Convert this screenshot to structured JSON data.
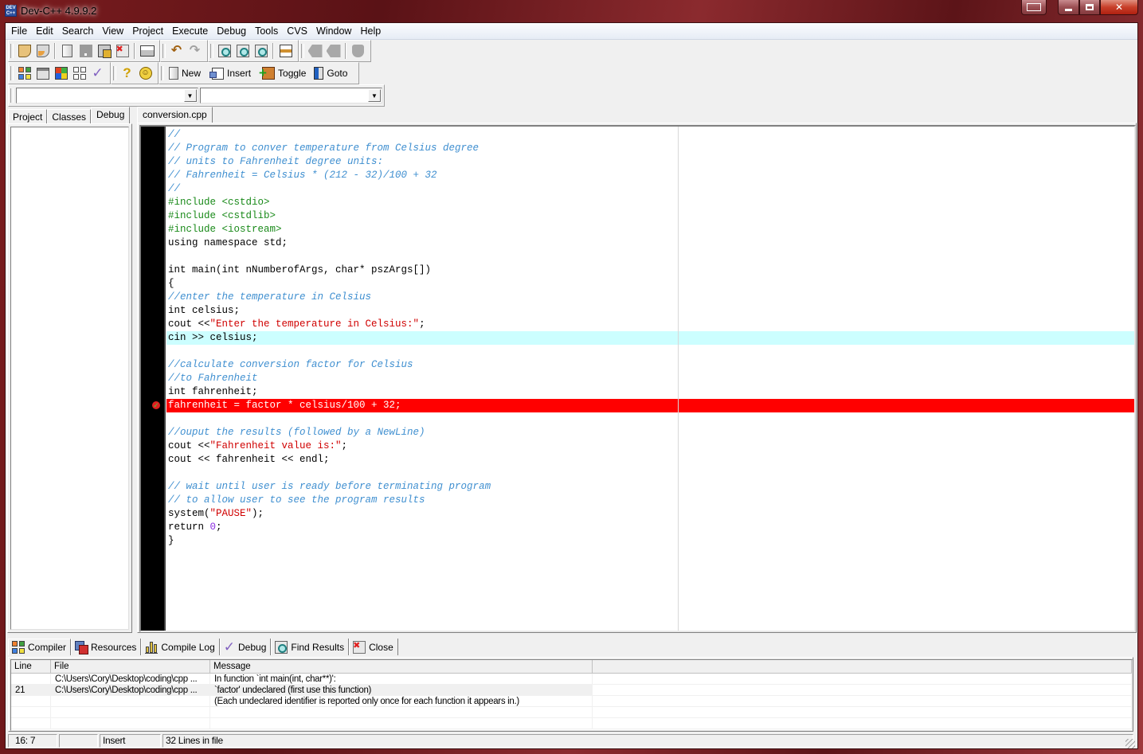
{
  "window": {
    "title": "Dev-C++ 4.9.9.2",
    "icon_text_top": "DEV",
    "icon_text_bottom": "C++",
    "controls": [
      "restore-down",
      "minimize",
      "maximize",
      "close"
    ]
  },
  "menu": [
    "File",
    "Edit",
    "Search",
    "View",
    "Project",
    "Execute",
    "Debug",
    "Tools",
    "CVS",
    "Window",
    "Help"
  ],
  "toolbar_main": {
    "buttons": [
      "open-project",
      "reopen",
      "new-source",
      "save",
      "save-all",
      "close-file",
      "print",
      "undo",
      "redo",
      "find",
      "find-next",
      "replace",
      "goto-line",
      "bookmark-prev",
      "bookmark-next",
      "shield"
    ]
  },
  "toolbar_secondary": {
    "buttons": [
      "compile",
      "run",
      "compile-run",
      "rebuild-all",
      "debug",
      "help",
      "about"
    ],
    "bookmark_buttons": {
      "new": "New",
      "insert": "Insert",
      "toggle": "Toggle",
      "goto": "Goto"
    }
  },
  "class_combos": {
    "class_value": "",
    "member_value": ""
  },
  "left_panel": {
    "tabs": [
      "Project",
      "Classes",
      "Debug"
    ],
    "active_tab": "Debug"
  },
  "editor": {
    "tabs": [
      "conversion.cpp"
    ],
    "active_tab": "conversion.cpp",
    "colors": {
      "comment": "#3f8fd0",
      "preprocessor": "#1a8a1a",
      "string": "#d00000",
      "number": "#8a2be2",
      "active_line_bg": "#ccfeff",
      "error_line_bg": "#ff0000"
    },
    "active_line": 16,
    "error_line": 21,
    "lines": [
      [
        [
          "comment",
          "//"
        ]
      ],
      [
        [
          "comment",
          "// Program to conver temperature from Celsius degree"
        ]
      ],
      [
        [
          "comment",
          "// units to Fahrenheit degree units:"
        ]
      ],
      [
        [
          "comment",
          "// Fahrenheit = Celsius * (212 - 32)/100 + 32"
        ]
      ],
      [
        [
          "comment",
          "//"
        ]
      ],
      [
        [
          "pre",
          "#include <cstdio>"
        ]
      ],
      [
        [
          "pre",
          "#include <cstdlib>"
        ]
      ],
      [
        [
          "pre",
          "#include <iostream>"
        ]
      ],
      [
        [
          "plain",
          "using namespace std;"
        ]
      ],
      [
        [
          "plain",
          ""
        ]
      ],
      [
        [
          "plain",
          "int main(int nNumberofArgs, char* pszArgs[])"
        ]
      ],
      [
        [
          "plain",
          "{"
        ]
      ],
      [
        [
          "comment",
          "//enter the temperature in Celsius"
        ]
      ],
      [
        [
          "plain",
          "int celsius;"
        ]
      ],
      [
        [
          "plain",
          "cout <<"
        ],
        [
          "str",
          "\"Enter the temperature in Celsius:\""
        ],
        [
          "plain",
          ";"
        ]
      ],
      [
        [
          "plain",
          "cin >> celsius;"
        ]
      ],
      [
        [
          "plain",
          ""
        ]
      ],
      [
        [
          "comment",
          "//calculate conversion factor for Celsius"
        ]
      ],
      [
        [
          "comment",
          "//to Fahrenheit"
        ]
      ],
      [
        [
          "plain",
          "int fahrenheit;"
        ]
      ],
      [
        [
          "plain",
          "fahrenheit = factor * celsius/100 + 32;"
        ]
      ],
      [
        [
          "plain",
          ""
        ]
      ],
      [
        [
          "comment",
          "//ouput the results (followed by a NewLine)"
        ]
      ],
      [
        [
          "plain",
          "cout <<"
        ],
        [
          "str",
          "\"Fahrenheit value is:\""
        ],
        [
          "plain",
          ";"
        ]
      ],
      [
        [
          "plain",
          "cout << fahrenheit << endl;"
        ]
      ],
      [
        [
          "plain",
          ""
        ]
      ],
      [
        [
          "comment",
          "// wait until user is ready before terminating program"
        ]
      ],
      [
        [
          "comment",
          "// to allow user to see the program results"
        ]
      ],
      [
        [
          "plain",
          "system("
        ],
        [
          "str",
          "\"PAUSE\""
        ],
        [
          "plain",
          ");"
        ]
      ],
      [
        [
          "plain",
          "return "
        ],
        [
          "num",
          "0"
        ],
        [
          "plain",
          ";"
        ]
      ],
      [
        [
          "plain",
          "}"
        ]
      ]
    ]
  },
  "bottom_panel": {
    "tabs": [
      {
        "label": "Compiler",
        "icon": "compiler-icon"
      },
      {
        "label": "Resources",
        "icon": "resources-icon"
      },
      {
        "label": "Compile Log",
        "icon": "compile-log-icon"
      },
      {
        "label": "Debug",
        "icon": "debug-check-icon"
      },
      {
        "label": "Find Results",
        "icon": "find-results-icon"
      },
      {
        "label": "Close",
        "icon": "close-panel-icon"
      }
    ],
    "active_tab": "Compiler",
    "columns": [
      "Line",
      "File",
      "Message"
    ],
    "rows": [
      {
        "line": "",
        "file": "C:\\Users\\Cory\\Desktop\\coding\\cpp ...",
        "message": "In function `int main(int, char**)':"
      },
      {
        "line": "21",
        "file": "C:\\Users\\Cory\\Desktop\\coding\\cpp ...",
        "message": "`factor' undeclared (first use this function)",
        "selected": true
      },
      {
        "line": "",
        "file": "",
        "message": "(Each undeclared identifier is reported only once for each function it appears in.)"
      },
      {
        "line": "",
        "file": "",
        "message": ""
      },
      {
        "line": "",
        "file": "",
        "message": ""
      }
    ]
  },
  "statusbar": {
    "position": "16: 7",
    "modified": "",
    "mode": "Insert",
    "lines_info": "32 Lines in file"
  }
}
